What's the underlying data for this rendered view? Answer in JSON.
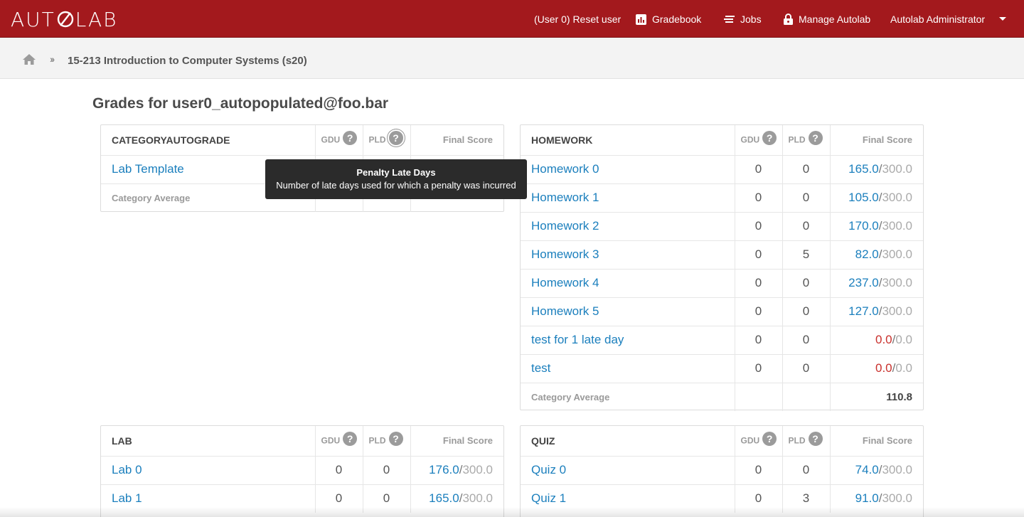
{
  "nav": {
    "brand": "AUTOLAB",
    "reset_user": "(User 0) Reset user",
    "gradebook": "Gradebook",
    "jobs": "Jobs",
    "manage": "Manage Autolab",
    "user": "Autolab Administrator"
  },
  "breadcrumb": {
    "course": "15-213 Introduction to Computer Systems (s20)"
  },
  "page_title": "Grades for user0_autopopulated@foo.bar",
  "headers": {
    "gdu": "GDU",
    "pld": "PLD",
    "final_score": "Final Score",
    "category_average": "Category Average"
  },
  "tooltip": {
    "title": "Penalty Late Days",
    "body": "Number of late days used for which a penalty was incurred"
  },
  "categories": {
    "categoryautograde": {
      "name": "CATEGORYAUTOGRADE",
      "rows": [
        {
          "name": "Lab Template"
        }
      ]
    },
    "homework": {
      "name": "HOMEWORK",
      "rows": [
        {
          "name": "Homework 0",
          "gdu": "0",
          "pld": "0",
          "score": "165.0",
          "max": "300.0"
        },
        {
          "name": "Homework 1",
          "gdu": "0",
          "pld": "0",
          "score": "105.0",
          "max": "300.0"
        },
        {
          "name": "Homework 2",
          "gdu": "0",
          "pld": "0",
          "score": "170.0",
          "max": "300.0"
        },
        {
          "name": "Homework 3",
          "gdu": "0",
          "pld": "5",
          "score": "82.0",
          "max": "300.0"
        },
        {
          "name": "Homework 4",
          "gdu": "0",
          "pld": "0",
          "score": "237.0",
          "max": "300.0"
        },
        {
          "name": "Homework 5",
          "gdu": "0",
          "pld": "0",
          "score": "127.0",
          "max": "300.0"
        },
        {
          "name": "test for 1 late day",
          "gdu": "0",
          "pld": "0",
          "score": "0.0",
          "max": "0.0"
        },
        {
          "name": "test",
          "gdu": "0",
          "pld": "0",
          "score": "0.0",
          "max": "0.0"
        }
      ],
      "average": "110.8"
    },
    "lab": {
      "name": "LAB",
      "rows": [
        {
          "name": "Lab 0",
          "gdu": "0",
          "pld": "0",
          "score": "176.0",
          "max": "300.0"
        },
        {
          "name": "Lab 1",
          "gdu": "0",
          "pld": "0",
          "score": "165.0",
          "max": "300.0"
        }
      ]
    },
    "quiz": {
      "name": "QUIZ",
      "rows": [
        {
          "name": "Quiz 0",
          "gdu": "0",
          "pld": "0",
          "score": "74.0",
          "max": "300.0"
        },
        {
          "name": "Quiz 1",
          "gdu": "0",
          "pld": "3",
          "score": "91.0",
          "max": "300.0"
        }
      ]
    }
  }
}
